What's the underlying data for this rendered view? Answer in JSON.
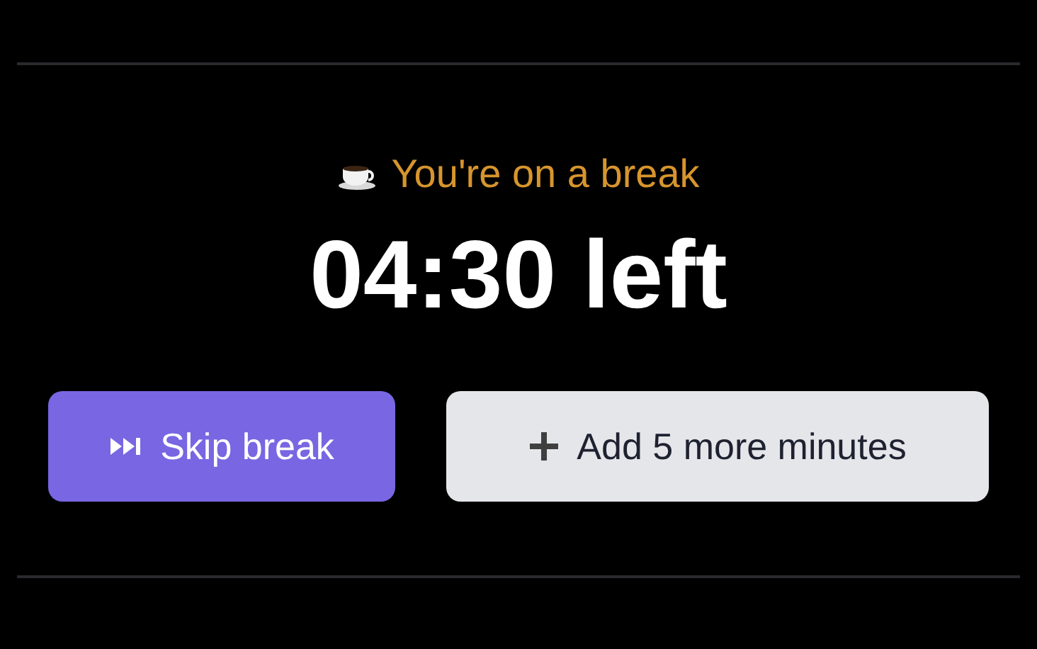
{
  "status": "You're on a break",
  "timer": "04:30 left",
  "buttons": [
    {
      "label": "Skip break",
      "kind": "primary"
    },
    {
      "label": "Add 5 more minutes",
      "kind": "secondary"
    }
  ]
}
